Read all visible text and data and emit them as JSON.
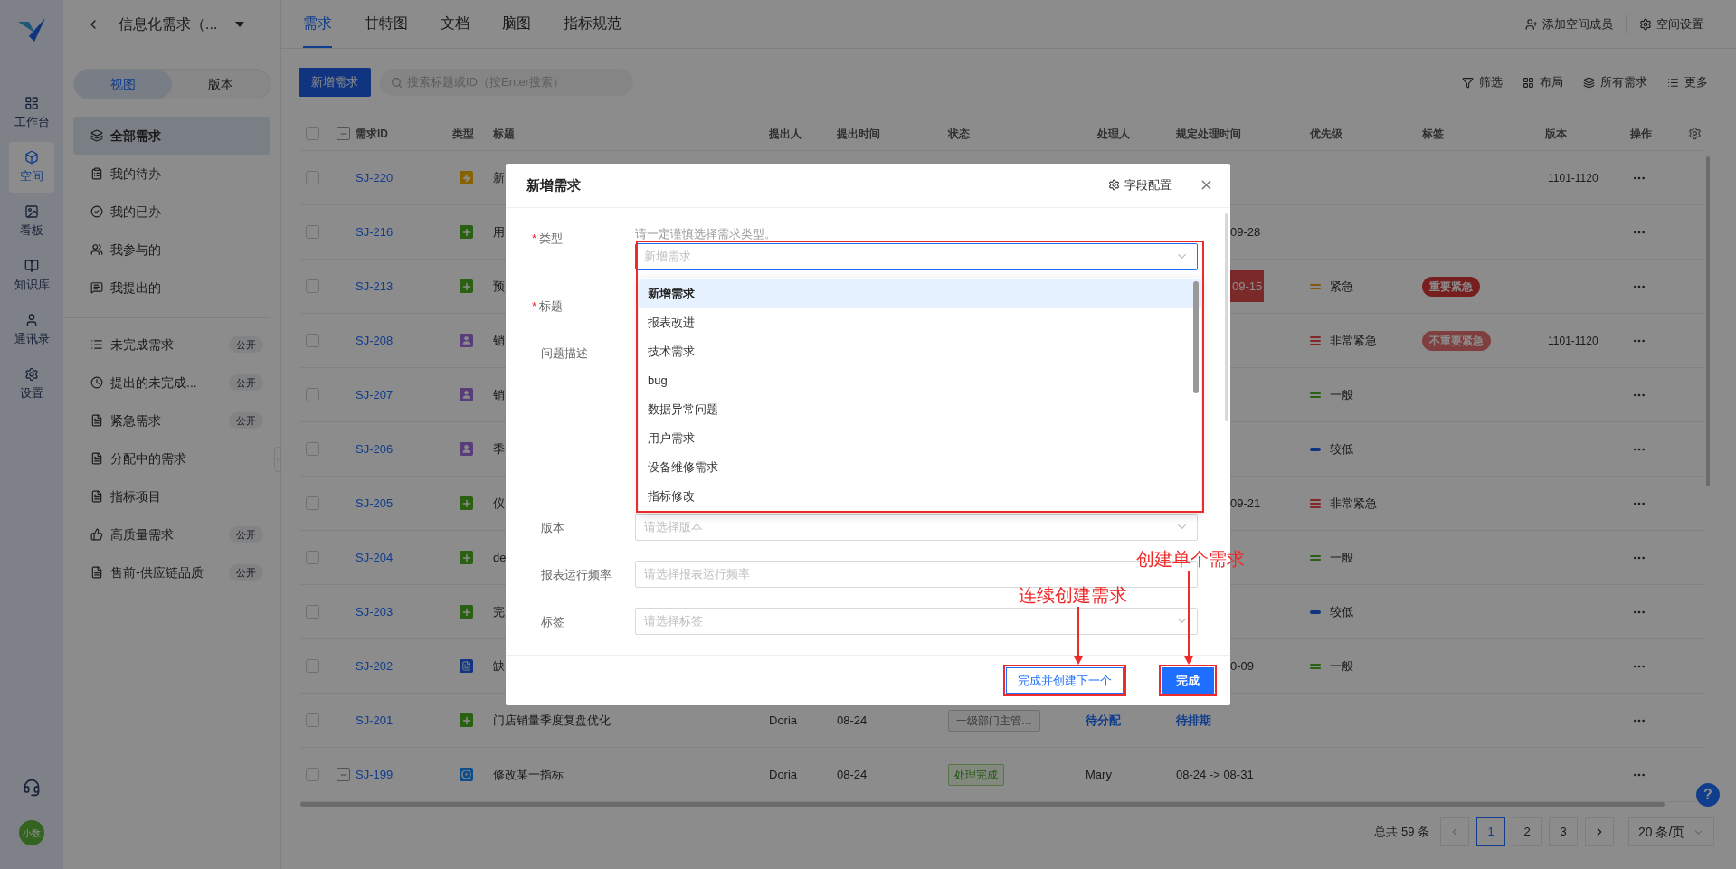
{
  "rail": {
    "items": [
      {
        "label": "工作台",
        "selected": false
      },
      {
        "label": "空间",
        "selected": true
      },
      {
        "label": "看板",
        "selected": false
      },
      {
        "label": "知识库",
        "selected": false
      },
      {
        "label": "通讯录",
        "selected": false
      },
      {
        "label": "设置",
        "selected": false
      }
    ],
    "avatar": "小数"
  },
  "space": {
    "title": "信息化需求（...",
    "segments": [
      {
        "label": "视图",
        "selected": true
      },
      {
        "label": "版本",
        "selected": false
      }
    ],
    "views": [
      {
        "label": "全部需求",
        "selected": true
      },
      {
        "label": "我的待办",
        "selected": false
      },
      {
        "label": "我的已办",
        "selected": false
      },
      {
        "label": "我参与的",
        "selected": false
      },
      {
        "label": "我提出的",
        "selected": false
      }
    ],
    "custom_views": [
      {
        "label": "未完成需求",
        "badge": "公开",
        "selected": false
      },
      {
        "label": "提出的未完成...",
        "badge": "公开",
        "selected": false
      },
      {
        "label": "紧急需求",
        "badge": "公开",
        "selected": false
      },
      {
        "label": "分配中的需求",
        "selected": false
      },
      {
        "label": "指标项目",
        "selected": false
      },
      {
        "label": "高质量需求",
        "badge": "公开",
        "selected": false
      },
      {
        "label": "售前-供应链品质",
        "badge": "公开",
        "selected": false
      }
    ]
  },
  "tabs": [
    {
      "label": "需求",
      "selected": true
    },
    {
      "label": "甘特图",
      "selected": false
    },
    {
      "label": "文档",
      "selected": false
    },
    {
      "label": "脑图",
      "selected": false
    },
    {
      "label": "指标规范",
      "selected": false
    }
  ],
  "header_actions": [
    "添加空间成员",
    "空间设置"
  ],
  "toolbar": {
    "new_button": "新增需求",
    "search": {
      "placeholder": "搜索标题或ID（按Enter搜索）"
    },
    "actions": [
      "筛选",
      "布局",
      "所有需求",
      "更多"
    ]
  },
  "table": {
    "header_checked": false,
    "columns": [
      "需求ID",
      "类型",
      "标题",
      "提出人",
      "提出时间",
      "状态",
      "处理人",
      "规定处理时间",
      "优先级",
      "标签",
      "版本",
      "操作"
    ],
    "rows": [
      {
        "checked": false,
        "has_children": false,
        "id": "SJ-220",
        "kind": "bolt",
        "title": "新",
        "version": "1101-1120"
      },
      {
        "checked": false,
        "has_children": false,
        "id": "SJ-216",
        "kind": "plus",
        "title": "用",
        "due": {
          "text": "09-28",
          "kind": "date",
          "partly_hidden": true,
          "overdue": false
        }
      },
      {
        "checked": false,
        "has_children": false,
        "id": "SJ-213",
        "kind": "plus",
        "title": "预",
        "due": {
          "text": "09-15",
          "kind": "date",
          "partly_hidden": true,
          "overdue": true
        },
        "priority": {
          "label": "紧急",
          "kind": "urgent"
        },
        "tag": {
          "label": "重要紧急",
          "kind": "important"
        }
      },
      {
        "checked": false,
        "has_children": false,
        "id": "SJ-208",
        "kind": "person",
        "title": "销",
        "priority": {
          "label": "非常紧急",
          "kind": "critical"
        },
        "tag": {
          "label": "不重要紧急",
          "kind": "minor"
        },
        "version": "1101-1120"
      },
      {
        "checked": false,
        "has_children": false,
        "id": "SJ-207",
        "kind": "person",
        "title": "销",
        "priority": {
          "label": "一般",
          "kind": "normal"
        }
      },
      {
        "checked": false,
        "has_children": false,
        "id": "SJ-206",
        "kind": "person",
        "title": "季",
        "priority": {
          "label": "较低",
          "kind": "low"
        }
      },
      {
        "checked": false,
        "has_children": false,
        "id": "SJ-205",
        "kind": "plus",
        "title": "仪",
        "due": {
          "text": "09-21",
          "kind": "date",
          "partly_hidden": true,
          "overdue": false
        },
        "priority": {
          "label": "非常紧急",
          "kind": "critical"
        }
      },
      {
        "checked": false,
        "has_children": false,
        "id": "SJ-204",
        "kind": "plus",
        "title": "de",
        "priority": {
          "label": "一般",
          "kind": "normal"
        }
      },
      {
        "checked": false,
        "has_children": false,
        "id": "SJ-203",
        "kind": "plus",
        "title": "完",
        "priority": {
          "label": "较低",
          "kind": "low"
        }
      },
      {
        "checked": false,
        "has_children": false,
        "id": "SJ-202",
        "kind": "doc",
        "title": "缺",
        "due": {
          "text": "0-09",
          "kind": "date",
          "partly_hidden": true,
          "overdue": false
        },
        "priority": {
          "label": "一般",
          "kind": "normal"
        }
      },
      {
        "checked": false,
        "has_children": false,
        "id": "SJ-201",
        "kind": "plus",
        "title": "门店销量季度复盘优化",
        "author": "Doria",
        "submitted": "08-24",
        "status": {
          "label": "一级部门主管…",
          "kind": "pending"
        },
        "assignee": {
          "text": "待分配",
          "kind": "action"
        },
        "due": {
          "text": "待排期",
          "kind": "action"
        }
      },
      {
        "checked": false,
        "has_children": true,
        "id": "SJ-199",
        "kind": "target",
        "title": "修改某一指标",
        "author": "Doria",
        "submitted": "08-24",
        "status": {
          "label": "处理完成",
          "kind": "done"
        },
        "assignee": {
          "text": "Mary",
          "kind": "name"
        },
        "due": {
          "text": "08-24 -> 08-31",
          "kind": "date",
          "partly_hidden": false,
          "overdue": false
        }
      }
    ]
  },
  "pagination": {
    "total": "总共 59 条",
    "pages": [
      {
        "label": "1",
        "selected": true
      },
      {
        "label": "2",
        "selected": false
      },
      {
        "label": "3",
        "selected": false
      }
    ],
    "page_size": "20 条/页"
  },
  "help": "?",
  "dialog": {
    "title": "新增需求",
    "config_label": "字段配置",
    "fields": [
      {
        "label": "类型",
        "required_mark": "*",
        "kind": "select",
        "hint": "请一定谨慎选择需求类型。",
        "placeholder": "新增需求",
        "focused": true,
        "options": [
          {
            "label": "新增需求",
            "selected": true
          },
          {
            "label": "报表改进",
            "selected": false
          },
          {
            "label": "技术需求",
            "selected": false
          },
          {
            "label": "bug",
            "selected": false
          },
          {
            "label": "数据异常问题",
            "selected": false
          },
          {
            "label": "用户需求",
            "selected": false
          },
          {
            "label": "设备维修需求",
            "selected": false
          },
          {
            "label": "指标修改",
            "selected": false
          }
        ]
      },
      {
        "label": "标题",
        "required_mark": "*",
        "kind": "text"
      },
      {
        "label": "问题描述",
        "kind": "editor"
      },
      {
        "label": "版本",
        "kind": "select",
        "placeholder": "请选择版本",
        "focused": false
      },
      {
        "label": "报表运行频率",
        "kind": "input",
        "placeholder": "请选择报表运行频率",
        "focused": false
      },
      {
        "label": "标签",
        "kind": "select",
        "placeholder": "请选择标签",
        "focused": false
      }
    ],
    "buttons": [
      {
        "label": "完成并创建下一个",
        "kind": "secondary"
      },
      {
        "label": "完成",
        "kind": "primary"
      }
    ]
  },
  "annotations": [
    {
      "text": "连续创建需求"
    },
    {
      "text": "创建单个需求"
    }
  ]
}
